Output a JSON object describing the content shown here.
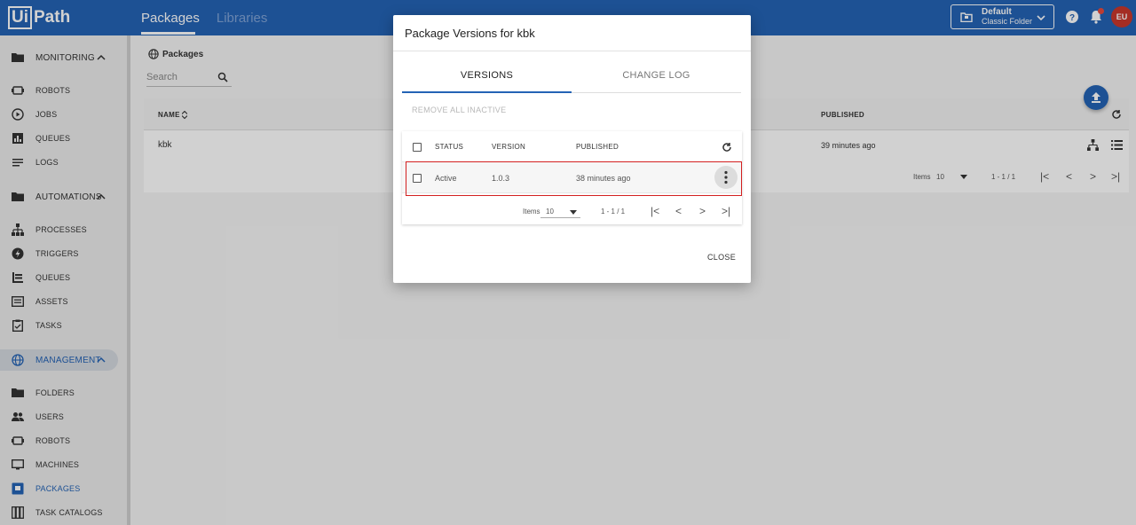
{
  "topbar": {
    "logo_boxed": "Ui",
    "logo_rest": "Path",
    "nav": [
      "Packages",
      "Libraries"
    ],
    "folder_line1": "Default",
    "folder_line2": "Classic Folder",
    "avatar": "EU"
  },
  "sidebar": {
    "monitoring": "MONITORING",
    "monitoring_items": [
      "ROBOTS",
      "JOBS",
      "QUEUES",
      "LOGS"
    ],
    "automations": "AUTOMATIONS",
    "automations_items": [
      "PROCESSES",
      "TRIGGERS",
      "QUEUES",
      "ASSETS",
      "TASKS"
    ],
    "management": "MANAGEMENT",
    "management_items": [
      "FOLDERS",
      "USERS",
      "ROBOTS",
      "MACHINES",
      "PACKAGES",
      "TASK CATALOGS"
    ]
  },
  "page": {
    "breadcrumb": "Packages",
    "search_placeholder": "Search",
    "columns": {
      "name": "NAME",
      "published": "PUBLISHED"
    },
    "row": {
      "name": "kbk",
      "published": "39 minutes ago"
    },
    "pager": {
      "items_label": "Items",
      "per_page": "10",
      "range": "1 - 1 / 1"
    }
  },
  "dialog": {
    "title": "Package Versions for kbk",
    "tabs": [
      "VERSIONS",
      "CHANGE LOG"
    ],
    "remove_inactive": "REMOVE ALL INACTIVE",
    "columns": {
      "status": "STATUS",
      "version": "VERSION",
      "published": "PUBLISHED"
    },
    "row": {
      "status": "Active",
      "version": "1.0.3",
      "published": "38 minutes ago"
    },
    "pager": {
      "items_label": "Items",
      "per_page": "10",
      "range": "1 - 1 / 1"
    },
    "close": "CLOSE"
  },
  "colors": {
    "brand": "#2463b5",
    "highlight": "#d32020"
  }
}
